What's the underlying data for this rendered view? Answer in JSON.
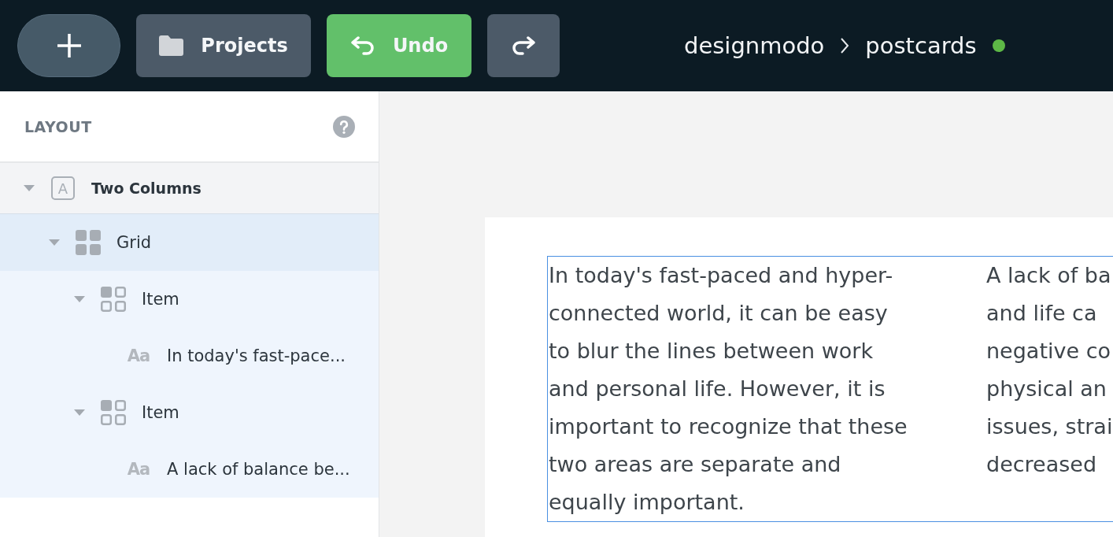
{
  "toolbar": {
    "buttons": [
      {
        "kind": "add"
      },
      {
        "kind": "projects",
        "label": "Projects"
      },
      {
        "kind": "undo",
        "label": "Undo"
      },
      {
        "kind": "redo"
      }
    ]
  },
  "breadcrumb": {
    "items": [
      "designmodo",
      "postcards"
    ],
    "online": true
  },
  "layout_panel": {
    "title": "LAYOUT",
    "tree": [
      {
        "kind": "section",
        "glyph": "A",
        "label": "Two Columns",
        "expanded": true,
        "selected": false,
        "children": [
          {
            "kind": "grid",
            "label": "Grid",
            "expanded": true,
            "selected": true,
            "children": [
              {
                "kind": "item",
                "label": "Item",
                "expanded": true,
                "selected": false,
                "children": [
                  {
                    "kind": "text",
                    "glyph": "Aa",
                    "label": "In today's fast-pace...",
                    "selected": false
                  }
                ]
              },
              {
                "kind": "item",
                "label": "Item",
                "expanded": true,
                "selected": false,
                "children": [
                  {
                    "kind": "text",
                    "glyph": "Aa",
                    "label": "A lack of balance be...",
                    "selected": false
                  }
                ]
              }
            ]
          }
        ]
      }
    ]
  },
  "canvas": {
    "selected": true,
    "columns": [
      {
        "lines": [
          "In today's fast-paced and hyper-",
          "connected world, it can be easy",
          "to blur the lines between work",
          "and personal life. However, it is",
          "important to recognize that these",
          "two areas are separate and",
          "equally important."
        ]
      },
      {
        "lines": [
          "A lack of ba",
          "and life ca",
          "negative co",
          "physical an",
          "issues, strai",
          "decreased"
        ]
      }
    ]
  }
}
